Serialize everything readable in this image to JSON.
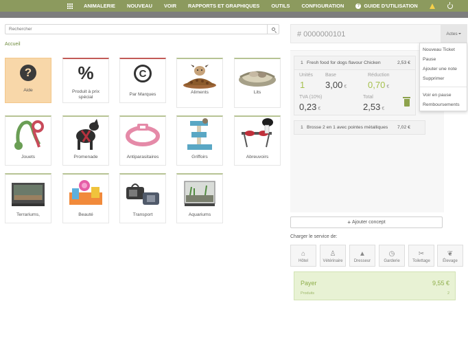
{
  "nav": {
    "items": [
      "ANIMALERIE",
      "NOUVEAU",
      "VOIR",
      "RAPPORTS ET GRAPHIQUES",
      "OUTILS",
      "CONFIGURATION"
    ],
    "help": "GUIDE D'UTILISATION",
    "icons": [
      "apps-grid-icon",
      "help-circle-icon",
      "warning-icon",
      "power-icon"
    ],
    "accent": "#8c9a5e"
  },
  "search": {
    "placeholder": "Rechercher"
  },
  "breadcrumb": "Accueil",
  "categories": [
    {
      "label": "Aide"
    },
    {
      "label": "Produit à prix spécial"
    },
    {
      "label": "Par Marques"
    },
    {
      "label": "Aliments"
    },
    {
      "label": "Lits"
    },
    {
      "label": "Jouets"
    },
    {
      "label": "Promenade"
    },
    {
      "label": "Antiparasitaires"
    },
    {
      "label": "Griffoirs"
    },
    {
      "label": "Abreuvoirs"
    },
    {
      "label": "Terrariums,"
    },
    {
      "label": "Beauté"
    },
    {
      "label": "Transport"
    },
    {
      "label": "Aquariums"
    }
  ],
  "ticket": {
    "number": "# 0000000101",
    "actes": "Actes",
    "menu": [
      "Nouveau Ticket",
      "Pause",
      "Ajouter une note",
      "Supprimer",
      "Voir en pause",
      "Remboursements"
    ],
    "lines": [
      {
        "qty": "1",
        "name": "Fresh food for dogs flavour Chicken",
        "price": "2,53 €"
      },
      {
        "qty": "1",
        "name": "Brosse 2 en 1 avec pointes métalliques",
        "price": "7,02 €"
      }
    ],
    "detail": {
      "unites_label": "Unités",
      "unites": "1",
      "base_label": "Base",
      "base": "3,00",
      "reduction_label": "Réduction",
      "reduction": "0,70",
      "tva_label": "TVA (10%)",
      "tva": "0,23",
      "total_label": "Total",
      "total": "2,53",
      "currency": "€"
    }
  },
  "add_concept": "Ajouter concept",
  "charger": "Charger le service de:",
  "services": [
    {
      "label": "Hôtel"
    },
    {
      "label": "Vétérinaire"
    },
    {
      "label": "Dresseur"
    },
    {
      "label": "Garderie"
    },
    {
      "label": "Toilettage"
    },
    {
      "label": "Élevage"
    }
  ],
  "payer": {
    "label": "Payer",
    "total": "9,55 €",
    "sub_label": "Produits",
    "count": "2"
  }
}
